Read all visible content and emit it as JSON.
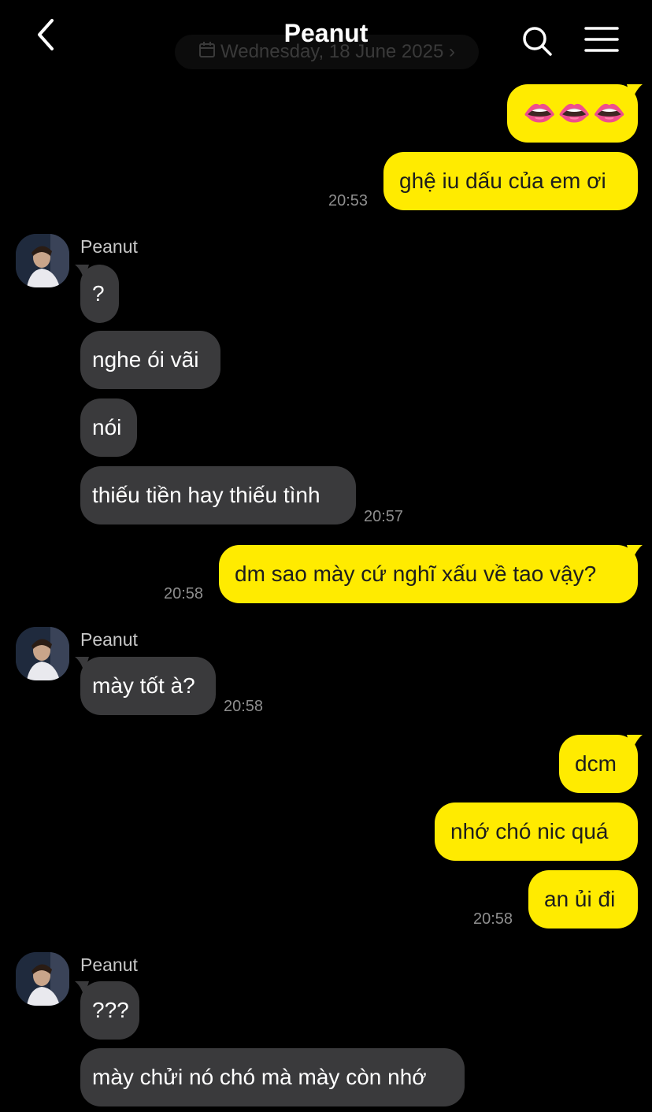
{
  "header": {
    "title": "Peanut",
    "date_pill": "Wednesday, 18 June 2025"
  },
  "icons": {
    "back": "chevron-left-icon",
    "search": "search-icon",
    "menu": "menu-icon",
    "calendar": "calendar-icon"
  },
  "colors": {
    "background": "#000000",
    "outgoing_bubble": "#ffeb00",
    "incoming_bubble": "#3a3a3c",
    "timestamp": "#8e8e8e"
  },
  "messages": {
    "m1": "👄👄👄",
    "m2": "ghệ iu dấu của em ơi",
    "t1": "20:53",
    "g1_sender": "Peanut",
    "m3": "?",
    "m4": "nghe ói vãi",
    "m5": "nói",
    "m6": "thiếu tiền hay thiếu tình",
    "t2": "20:57",
    "m7": "dm sao mày cứ nghĩ xấu về tao vậy?",
    "t3": "20:58",
    "g2_sender": "Peanut",
    "m8": "mày tốt à?",
    "t4": "20:58",
    "m9": "dcm",
    "m10": "nhớ chó nic quá",
    "m11": "an ủi đi",
    "t5": "20:58",
    "g3_sender": "Peanut",
    "m12": "???",
    "m13": "mày chửi nó chó mà mày còn nhớ"
  }
}
